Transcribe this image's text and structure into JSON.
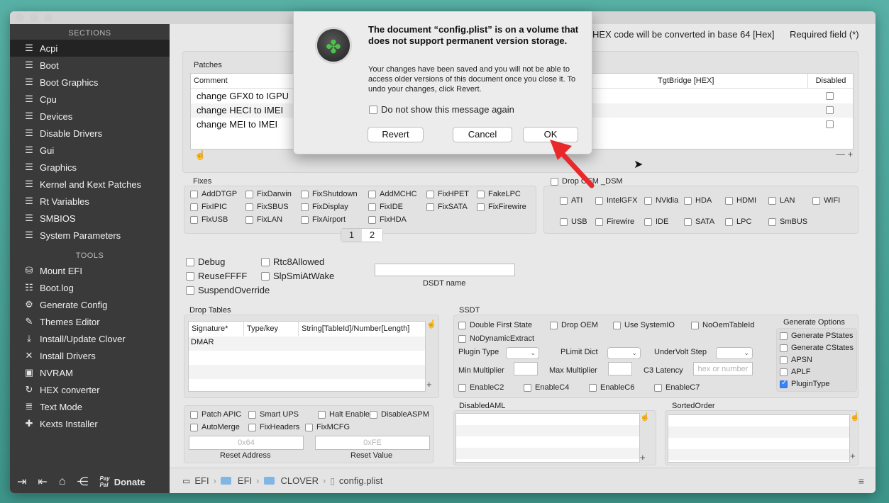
{
  "sidebar": {
    "sections_header": "SECTIONS",
    "tools_header": "TOOLS",
    "sections": [
      {
        "label": "Acpi",
        "icon": "list-icon"
      },
      {
        "label": "Boot",
        "icon": "list-icon"
      },
      {
        "label": "Boot Graphics",
        "icon": "list-icon"
      },
      {
        "label": "Cpu",
        "icon": "list-icon"
      },
      {
        "label": "Devices",
        "icon": "list-icon"
      },
      {
        "label": "Disable Drivers",
        "icon": "list-icon"
      },
      {
        "label": "Gui",
        "icon": "list-icon"
      },
      {
        "label": "Graphics",
        "icon": "list-icon"
      },
      {
        "label": "Kernel and Kext Patches",
        "icon": "list-icon"
      },
      {
        "label": "Rt Variables",
        "icon": "list-icon"
      },
      {
        "label": "SMBIOS",
        "icon": "list-icon"
      },
      {
        "label": "System Parameters",
        "icon": "list-icon"
      }
    ],
    "tools": [
      {
        "label": "Mount EFI",
        "icon": "disk-icon"
      },
      {
        "label": "Boot.log",
        "icon": "log-icon"
      },
      {
        "label": "Generate Config",
        "icon": "gears-icon"
      },
      {
        "label": "Themes Editor",
        "icon": "paint-icon"
      },
      {
        "label": "Install/Update Clover",
        "icon": "download-icon"
      },
      {
        "label": "Install Drivers",
        "icon": "tools-icon"
      },
      {
        "label": "NVRAM",
        "icon": "chip-icon"
      },
      {
        "label": "HEX converter",
        "icon": "refresh-icon"
      },
      {
        "label": "Text Mode",
        "icon": "text-icon"
      },
      {
        "label": "Kexts Installer",
        "icon": "puzzle-icon"
      }
    ],
    "bottom": {
      "paypal_line1": "Pay",
      "paypal_line2": "Pal",
      "donate": "Donate"
    }
  },
  "header": {
    "hex_note": "HEX code will be converted in base 64 [Hex]",
    "required_note": "Required field (*)"
  },
  "patches": {
    "label": "Patches",
    "col_comment": "Comment",
    "col_tgtbridge": "TgtBridge [HEX]",
    "col_disabled": "Disabled",
    "rows": [
      "change GFX0 to IGPU",
      "change HECI to IMEI",
      "change MEI to IMEI"
    ]
  },
  "fixes": {
    "label": "Fixes",
    "items": [
      "AddDTGP",
      "FixDarwin",
      "FixShutdown",
      "AddMCHC",
      "FixHPET",
      "FakeLPC",
      "FixIPIC",
      "FixSBUS",
      "FixDisplay",
      "FixIDE",
      "FixSATA",
      "FixFirewire",
      "FixUSB",
      "FixLAN",
      "FixAirport",
      "FixHDA"
    ],
    "pages": [
      "1",
      "2"
    ]
  },
  "drop_dsm": {
    "label": "Drop OEM _DSM",
    "row1": [
      "ATI",
      "IntelGFX",
      "NVidia",
      "HDA",
      "HDMI",
      "LAN",
      "WIFI"
    ],
    "row2": [
      "USB",
      "Firewire",
      "IDE",
      "SATA",
      "LPC",
      "SmBUS"
    ]
  },
  "general": {
    "checks": [
      "Debug",
      "Rtc8Allowed",
      "ReuseFFFF",
      "SlpSmiAtWake",
      "SuspendOverride"
    ],
    "dsdt_name_label": "DSDT name"
  },
  "drop_tables": {
    "label": "Drop Tables",
    "col_signature": "Signature*",
    "col_type": "Type/key",
    "col_string": "String[TableId]/Number[Length]",
    "first_row": "DMAR"
  },
  "ssdt": {
    "label": "SSDT",
    "checks_row1": [
      "Double First State",
      "Drop OEM",
      "Use SystemIO",
      "NoOemTableId"
    ],
    "checks_row2": [
      "NoDynamicExtract"
    ],
    "plugin_type": "Plugin Type",
    "plimit_dict": "PLimit Dict",
    "undervolt_step": "UnderVolt Step",
    "min_multiplier": "Min Multiplier",
    "max_multiplier": "Max Multiplier",
    "c3_latency": "C3 Latency",
    "c3_placeholder": "hex or number",
    "checks_row3": [
      "EnableC2",
      "EnableC4",
      "EnableC6",
      "EnableC7"
    ],
    "generate_options": "Generate Options",
    "gen_items": [
      {
        "label": "Generate PStates",
        "checked": false
      },
      {
        "label": "Generate CStates",
        "checked": false
      },
      {
        "label": "APSN",
        "checked": false
      },
      {
        "label": "APLF",
        "checked": false
      },
      {
        "label": "PluginType",
        "checked": true
      }
    ]
  },
  "patch_apic": {
    "checks": [
      "Patch APIC",
      "Smart UPS",
      "Halt Enabler",
      "DisableASPM",
      "AutoMerge",
      "FixHeaders",
      "FixMCFG"
    ],
    "reset_address_value": "0x64",
    "reset_value_value": "0xFE",
    "reset_address_label": "Reset Address",
    "reset_value_label": "Reset Value"
  },
  "disabled_aml": {
    "label": "DisabledAML"
  },
  "sorted_order": {
    "label": "SortedOrder"
  },
  "pathbar": {
    "items": [
      "EFI",
      "EFI",
      "CLOVER",
      "config.plist"
    ]
  },
  "dialog": {
    "title": "The document “config.plist” is on a volume that does not support permanent version storage.",
    "message": "Your changes have been saved and you will not be able to access older versions of this document once you close it. To undo your changes, click Revert.",
    "checkbox": "Do not show this message again",
    "revert": "Revert",
    "cancel": "Cancel",
    "ok": "OK"
  },
  "colors": {
    "sidebar_bg": "#3a3a3a",
    "accent": "#3b82f6",
    "arrow": "#e8282b"
  }
}
